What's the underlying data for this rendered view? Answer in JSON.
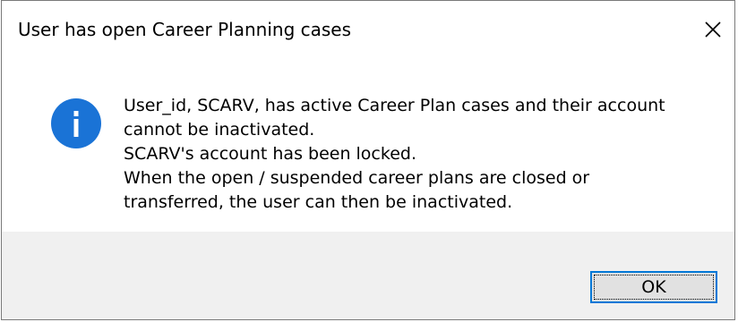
{
  "dialog": {
    "title": "User has open Career Planning cases",
    "icon": "info-icon",
    "message_lines": [
      "User_id, SCARV, has active Career Plan cases and their account",
      "cannot be inactivated.",
      "SCARV's account has been locked.",
      "When the open / suspended career plans are closed or",
      "transferred, the user can then be inactivated."
    ],
    "ok_label": "OK",
    "close_icon": "close-icon"
  },
  "colors": {
    "accent": "#0078d7",
    "footer_bg": "#f0f0f0",
    "button_bg": "#e1e1e1"
  }
}
